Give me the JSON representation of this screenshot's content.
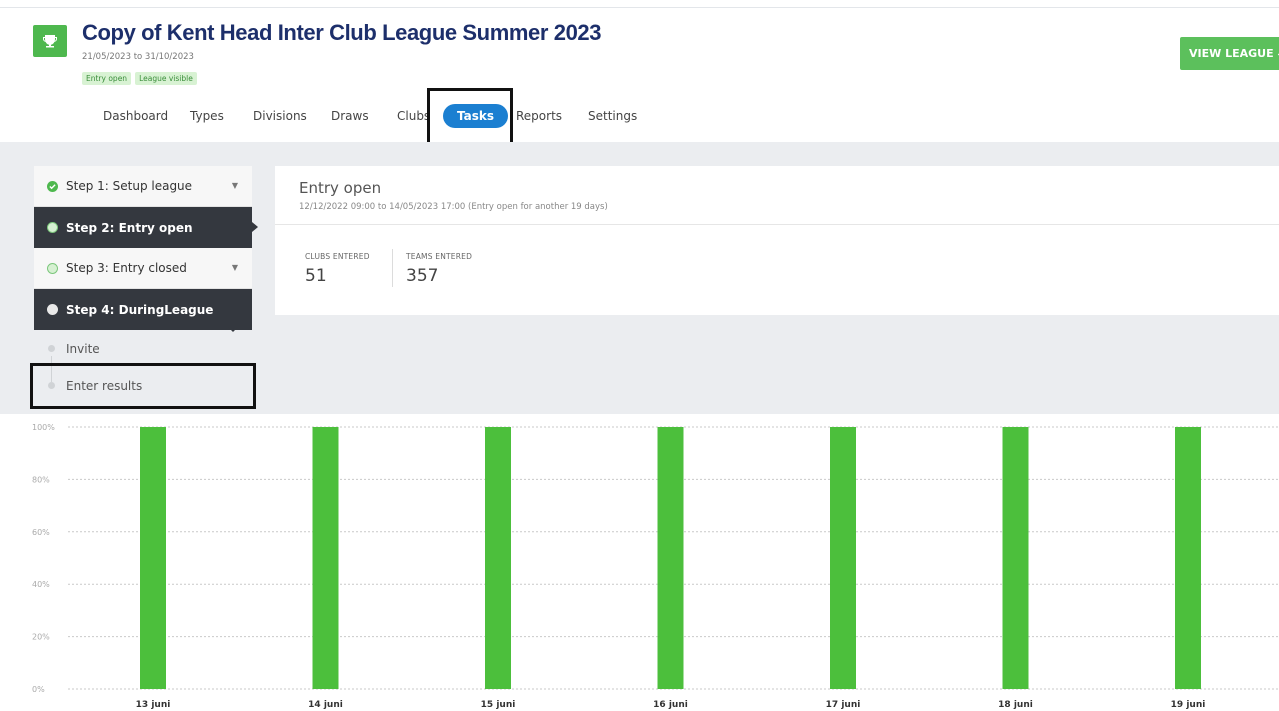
{
  "league": {
    "title": "Copy of Kent Head Inter Club League Summer 2023",
    "dates": "21/05/2023 to 31/10/2023",
    "badges": [
      "Entry open",
      "League visible"
    ],
    "view_button": "VIEW LEAGUE",
    "accent": "#4eb84e",
    "title_color": "#1d2f6b"
  },
  "nav": {
    "items": [
      "Dashboard",
      "Types",
      "Divisions",
      "Draws",
      "Clubs",
      "Tasks",
      "Reports",
      "Settings"
    ],
    "active": "Tasks",
    "active_color": "#1b7fd1"
  },
  "steps": {
    "items": [
      {
        "label": "Step 1: Setup league",
        "state": "done"
      },
      {
        "label": "Step 2: Entry open",
        "state": "current"
      },
      {
        "label": "Step 3: Entry closed",
        "state": "pending"
      },
      {
        "label": "Step 4: DuringLeague",
        "state": "expanded"
      }
    ],
    "substeps": [
      "Invite",
      "Enter results"
    ]
  },
  "entry": {
    "title": "Entry open",
    "subtitle": "12/12/2022 09:00 to 14/05/2023 17:00 (Entry open for another 19 days)",
    "clubs_label": "CLUBS ENTERED",
    "clubs_value": "51",
    "teams_label": "TEAMS ENTERED",
    "teams_value": "357"
  },
  "chart_data": {
    "type": "bar",
    "categories": [
      "13 juni",
      "14 juni",
      "15 juni",
      "16 juni",
      "17 juni",
      "18 juni",
      "19 juni"
    ],
    "values": [
      100,
      100,
      100,
      100,
      100,
      100,
      100
    ],
    "yticks": [
      "0%",
      "20%",
      "40%",
      "60%",
      "80%",
      "100%"
    ],
    "ylim": [
      0,
      100
    ],
    "bar_color": "#4cbf3c",
    "grid": true
  }
}
